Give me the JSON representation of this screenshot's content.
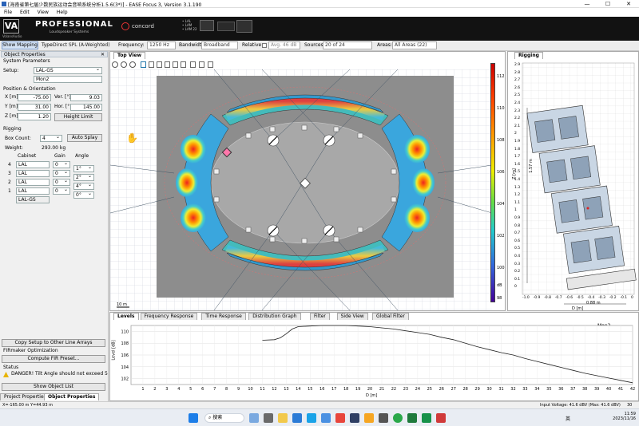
{
  "window": {
    "title": "[海南省第七届少数民族运动会音响系统分析1.5.6(3*)] - EASE Focus 3, Version 3.1.190",
    "minimize": "—",
    "maximize": "☐",
    "close": "✕"
  },
  "menu": [
    "File",
    "Edit",
    "View",
    "Help"
  ],
  "banner": {
    "brand": "PROFESSIONAL",
    "brand_sub": "Loudspeaker Systems",
    "va_text": "VA",
    "va_sub": "VolansAudio",
    "concord": "concord",
    "model_list": [
      "• LAL",
      "• LAM",
      "• LAM 22"
    ]
  },
  "toolbar": {
    "show_mapping": "Show Mapping",
    "type_label": "Type:",
    "type_value": "Direct SPL (A-Weighted)",
    "frequency_label": "Frequency:",
    "frequency_value": "1250 Hz",
    "bandwidth_label": "Bandwidth:",
    "bandwidth_value": "Broadband",
    "relative_label": "Relative:",
    "relative_value": "Avg. 46 dB",
    "sources_label": "Sources:",
    "sources_value": "20 of 24",
    "areas_label": "Areas:",
    "areas_value": "All Areas (22)"
  },
  "left": {
    "header": "Object Properties",
    "system_params": "System Parameters",
    "setup_label": "Setup:",
    "setup_value": "LAL-GS",
    "name_value": "Mon2",
    "pos_header": "Position & Orientation",
    "x_label": "X [m]:",
    "x_value": "-75.00",
    "y_label": "Y [m]:",
    "y_value": "31.00",
    "z_label": "Z [m]:",
    "z_value": "1.20",
    "ver_label": "Ver. [°]:",
    "ver_value": "9.03",
    "hor_label": "Hor. [°]:",
    "hor_value": "145.00",
    "height_limit": "Height Limit",
    "rigging_header": "Rigging",
    "box_count_label": "Box Count:",
    "box_count_value": "4",
    "auto_splay": "Auto Splay",
    "weight_label": "Weight:",
    "weight_value": "293.00 kg",
    "col_cabinet": "Cabinet",
    "col_gain": "Gain",
    "col_angle": "Angle",
    "cabinets": [
      {
        "idx": "4",
        "name": "LAL",
        "gain": "0",
        "angle": "1°"
      },
      {
        "idx": "3",
        "name": "LAL",
        "gain": "0",
        "angle": "2°"
      },
      {
        "idx": "2",
        "name": "LAL",
        "gain": "0",
        "angle": "4°"
      },
      {
        "idx": "1",
        "name": "LAL",
        "gain": "0",
        "angle": "0°"
      }
    ],
    "frame_name": "LAL-GS",
    "copy_setup": "Copy Setup to Other Line Arrays",
    "fir_header": "FIRmaker Optimization",
    "compute_fir": "Compute FIR Preset...",
    "status_header": "Status",
    "status_msg": "DANGER! Tilt Angle should not exceed 5 degree!",
    "show_object_list": "Show Object List",
    "tab_project": "Project Properties",
    "tab_object": "Object Properties"
  },
  "center": {
    "tab": "Top View",
    "scale_label": "10 m",
    "colorbar_ticks": [
      "112",
      "110",
      "108",
      "106",
      "104",
      "102",
      "100",
      "98"
    ],
    "colorbar_unit": "dB"
  },
  "right": {
    "tab": "Rigging",
    "yticks": [
      "2.9",
      "2.8",
      "2.7",
      "2.6",
      "2.5",
      "2.4",
      "2.3",
      "2.2",
      "2.1",
      "2",
      "1.9",
      "1.8",
      "1.7",
      "1.6",
      "1.5",
      "1.4",
      "1.3",
      "1.2",
      "1.1",
      "1",
      "0.9",
      "0.8",
      "0.7",
      "0.6",
      "0.5",
      "0.4",
      "0.3",
      "0.2",
      "0.1",
      "0"
    ],
    "xticks": [
      "-1.0",
      "-0.9",
      "-0.8",
      "-0.7",
      "-0.6",
      "-0.5",
      "-0.4",
      "-0.3",
      "-0.2",
      "-0.1",
      "0"
    ],
    "xlabel": "D [m]",
    "ylabel": "Z [m]",
    "dim_height": "1.57 m",
    "dim_width": "0.88 m"
  },
  "bottom": {
    "tabs": [
      "Levels",
      "Frequency Response",
      "Time Response",
      "Distribution Graph",
      "Filter",
      "Side View",
      "Global Filter"
    ],
    "series_name": "Mon2",
    "ylabel": "Level [dB]",
    "xlabel": "D [m]"
  },
  "chart_data": {
    "type": "line",
    "title": "",
    "xlabel": "D [m]",
    "ylabel": "Level [dB]",
    "xlim": [
      0,
      42
    ],
    "ylim": [
      101,
      111
    ],
    "xticks": [
      1,
      2,
      3,
      4,
      5,
      6,
      7,
      8,
      9,
      10,
      11,
      12,
      13,
      14,
      15,
      16,
      17,
      18,
      19,
      20,
      21,
      22,
      23,
      24,
      25,
      26,
      27,
      28,
      29,
      30,
      31,
      32,
      33,
      34,
      35,
      36,
      37,
      38,
      39,
      40,
      41,
      42
    ],
    "yticks": [
      102,
      104,
      106,
      108,
      110
    ],
    "series": [
      {
        "name": "Mon2",
        "x": [
          11,
          12,
          12.5,
          13,
          13.5,
          14,
          15,
          16,
          17,
          18,
          19,
          20,
          21,
          22,
          23,
          24,
          25,
          26,
          27,
          28,
          29,
          30,
          31,
          32,
          33,
          34,
          35,
          36,
          37,
          38,
          39,
          40,
          41,
          42
        ],
        "y": [
          108.5,
          108.6,
          108.9,
          109.6,
          110.4,
          110.8,
          110.9,
          111.0,
          111.0,
          111.0,
          110.9,
          110.8,
          110.6,
          110.4,
          110.1,
          109.8,
          109.5,
          109.0,
          108.6,
          108.0,
          107.4,
          106.9,
          106.4,
          106.0,
          105.4,
          104.9,
          104.4,
          103.9,
          103.4,
          102.9,
          102.5,
          102.1,
          101.7,
          101.3
        ]
      }
    ]
  },
  "statusbar": {
    "coords": "X=-165.00 m Y=44.93 m",
    "input_voltage": "Input Voltage: 41.6 dBV (Max: 41.6 dBV)",
    "zoom": "30"
  },
  "taskbar": {
    "search": "搜索",
    "lang": "英",
    "time": "11:59",
    "date": "2023/11/16"
  },
  "colors": {
    "accent": "#2a63b8",
    "warning": "#e8b400",
    "banner_bg": "#121212"
  }
}
